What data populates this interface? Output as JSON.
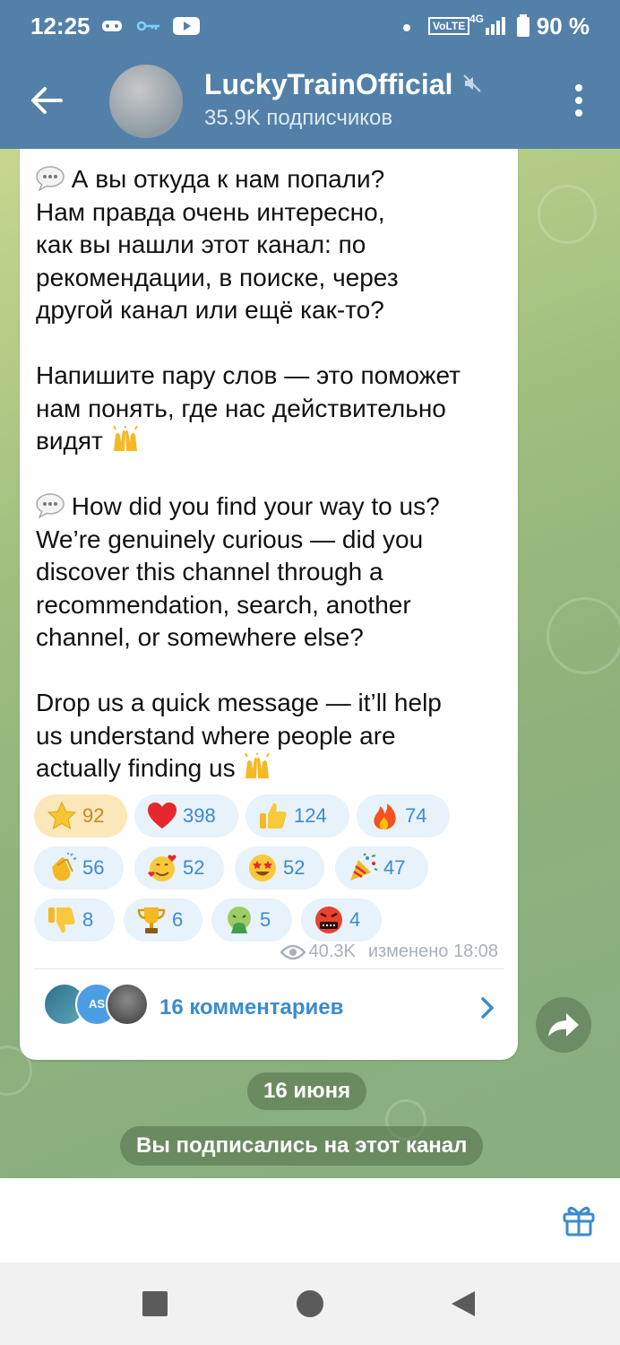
{
  "status_bar": {
    "time": "12:25",
    "battery": "90 %",
    "network": "VoLTE",
    "signal": "4G"
  },
  "channel": {
    "title": "LuckyTrainOfficial",
    "subtitle": "35.9K подписчиков"
  },
  "post": {
    "ru_paragraph_1": "А вы откуда к нам попали?\nНам правда очень интересно,\nкак вы нашли этот канал: по\nрекомендации, в поиске, через\nдругой канал или ещё как-то?",
    "ru_paragraph_2": "Напишите пару слов — это поможет\nнам понять, где нас действительно\nвидят",
    "en_paragraph_1": "How did you find your way to us?\nWe’re genuinely curious — did you\ndiscover this channel through a\nrecommendation, search, another\nchannel, or somewhere else?",
    "en_paragraph_2": "Drop us a quick message — it’ll help\nus understand where people are\nactually finding us",
    "views": "40.3K",
    "edited": "изменено 18:08"
  },
  "reactions": [
    {
      "emoji": "star",
      "count": "92",
      "active": true
    },
    {
      "emoji": "heart",
      "count": "398"
    },
    {
      "emoji": "thumbs-up",
      "count": "124"
    },
    {
      "emoji": "fire",
      "count": "74"
    },
    {
      "emoji": "clapping",
      "count": "56"
    },
    {
      "emoji": "smiling-hearts",
      "count": "52"
    },
    {
      "emoji": "star-struck",
      "count": "52"
    },
    {
      "emoji": "party-popper",
      "count": "47"
    },
    {
      "emoji": "thumbs-down",
      "count": "8"
    },
    {
      "emoji": "trophy",
      "count": "6"
    },
    {
      "emoji": "nauseated",
      "count": "5"
    },
    {
      "emoji": "cursing",
      "count": "4"
    }
  ],
  "comments": {
    "label": "16 комментариев",
    "avatar_initials": "AS"
  },
  "date_separator": "16 июня",
  "service_message": "Вы подписались на этот канал",
  "colors": {
    "header": "#5280a8",
    "accent": "#3a8bd1",
    "reaction_bg": "#e8f2fb",
    "active_reaction_bg": "#fbe7b9"
  }
}
